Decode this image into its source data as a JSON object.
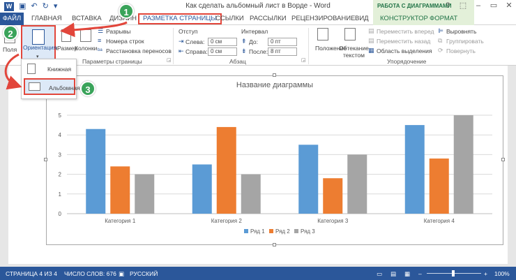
{
  "window": {
    "title": "Как сделать альбомный лист в Ворде - Word",
    "context_title": "РАБОТА С ДИАГРАММАМИ",
    "qat_icons": [
      "word-logo-icon",
      "save-icon",
      "undo-icon",
      "redo-icon",
      "customize-icon"
    ],
    "window_buttons": [
      "help-icon",
      "ribbon-options-icon",
      "minimize-icon",
      "restore-icon",
      "close-icon"
    ]
  },
  "tabs": {
    "file": "ФАЙЛ",
    "home": "ГЛАВНАЯ",
    "insert": "ВСТАВКА",
    "design": "ДИЗАЙН",
    "layout": "РАЗМЕТКА СТРАНИЦЫ",
    "references": "ССЫЛКИ",
    "mailings": "РАССЫЛКИ",
    "review": "РЕЦЕНЗИРОВАНИЕ",
    "view": "ВИД",
    "constructor": "КОНСТРУКТОР",
    "format": "ФОРМАТ"
  },
  "ribbon": {
    "page_setup": {
      "fields": "Поля",
      "orientation": "Ориентация",
      "size": "Размер",
      "columns": "Колонки",
      "breaks": "Разрывы",
      "line_numbers": "Номера строк",
      "hyphenation": "Расстановка переносов",
      "group_label": "Параметры страницы"
    },
    "paragraph": {
      "indent_header": "Отступ",
      "left_label": "Слева:",
      "left_value": "0 см",
      "right_label": "Справа:",
      "right_value": "0 см",
      "spacing_header": "Интервал",
      "before_label": "До:",
      "before_value": "0 пт",
      "after_label": "После:",
      "after_value": "8 пт",
      "group_label": "Абзац"
    },
    "arrange": {
      "position": "Положение",
      "wrap_line1": "Обтекание",
      "wrap_line2": "текстом",
      "forward": "Переместить вперед",
      "backward": "Переместить назад",
      "selection_pane": "Область выделения",
      "align": "Выровнять",
      "group": "Группировать",
      "rotate": "Повернуть",
      "group_label": "Упорядочение"
    }
  },
  "orientation_menu": {
    "portrait": "Книжная",
    "landscape": "Альбомная"
  },
  "markers": [
    "1",
    "2",
    "3"
  ],
  "chart_data": {
    "type": "bar",
    "title": "Название диаграммы",
    "categories": [
      "Категория 1",
      "Категория 2",
      "Категория 3",
      "Категория 4"
    ],
    "series": [
      {
        "name": "Ряд 1",
        "color": "#5b9bd5",
        "values": [
          4.3,
          2.5,
          3.5,
          4.5
        ]
      },
      {
        "name": "Ряд 2",
        "color": "#ed7d31",
        "values": [
          2.4,
          4.4,
          1.8,
          2.8
        ]
      },
      {
        "name": "Ряд 3",
        "color": "#a5a5a5",
        "values": [
          2.0,
          2.0,
          3.0,
          5.0
        ]
      }
    ],
    "yticks": [
      "0",
      "1",
      "2",
      "3",
      "4",
      "5"
    ],
    "ylim": [
      0,
      5
    ],
    "grid": true,
    "legend": "bottom"
  },
  "status": {
    "page": "СТРАНИЦА 4 ИЗ 4",
    "words": "ЧИСЛО СЛОВ: 676",
    "language": "РУССКИЙ",
    "zoom": "100%"
  }
}
